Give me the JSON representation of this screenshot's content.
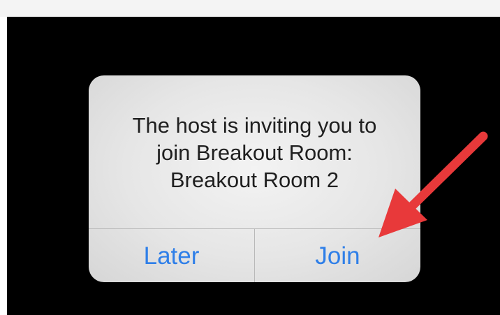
{
  "alert": {
    "message": "The host is inviting you to\njoin Breakout Room:\nBreakout Room 2",
    "later_label": "Later",
    "join_label": "Join",
    "button_color": "#2f7fe8"
  },
  "annotation": {
    "arrow_color": "#e8393a",
    "arrow_target": "join-button",
    "icon": "arrow-icon"
  }
}
